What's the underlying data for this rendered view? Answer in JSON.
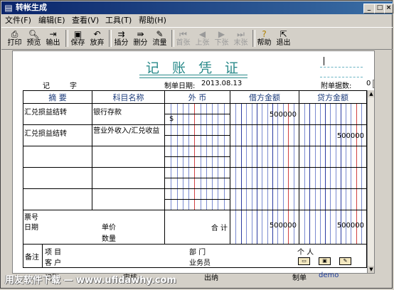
{
  "window": {
    "title": "转帐生成",
    "minimize": "_",
    "maximize": "□",
    "close": "×"
  },
  "menu": [
    "文件(F)",
    "编辑(E)",
    "查看(V)",
    "工具(T)",
    "帮助(H)"
  ],
  "toolbar": {
    "print": "打印",
    "preview": "预览",
    "export": "输出",
    "save": "保存",
    "discard": "放弃",
    "insert": "插分",
    "delete": "删分",
    "flow": "流量",
    "first": "首张",
    "prev": "上张",
    "next": "下张",
    "last": "末张",
    "help": "帮助",
    "exit": "退出"
  },
  "voucher": {
    "title": "记 账 凭 证",
    "ji": "记",
    "zi": "字",
    "date_label": "制单日期:",
    "date": "2013.08.13",
    "attach_label": "附单据数:",
    "attach_value": "0",
    "headers": {
      "summary": "摘 要",
      "subject": "科目名称",
      "foreign": "外 币",
      "debit": "借方金额",
      "credit": "贷方金额"
    },
    "rows": [
      {
        "summary": "汇兑损益结转",
        "subject": "银行存款",
        "foreign": "$",
        "debit": "500000",
        "credit": ""
      },
      {
        "summary": "汇兑损益结转",
        "subject": "营业外收入/汇兑收益",
        "foreign": "",
        "debit": "",
        "credit": "500000"
      },
      {
        "summary": "",
        "subject": "",
        "foreign": "",
        "debit": "",
        "credit": ""
      },
      {
        "summary": "",
        "subject": "",
        "foreign": "",
        "debit": "",
        "credit": ""
      },
      {
        "summary": "",
        "subject": "",
        "foreign": "",
        "debit": "",
        "credit": ""
      }
    ],
    "footer": {
      "ticket_no": "票号",
      "date": "日期",
      "unit_price": "单价",
      "quantity": "数量",
      "total": "合 计",
      "debit_total": "500000",
      "credit_total": "500000"
    },
    "notes": {
      "label": "备注",
      "project": "项 目",
      "customer": "客 户",
      "department": "部 门",
      "person": "个 人",
      "salesman": "业务员"
    }
  },
  "bottom": {
    "bookkeeper": "记账",
    "reviewer": "审核",
    "cashier": "出纳",
    "maker_label": "制单",
    "maker": "demo"
  },
  "watermark": "用友软件下载 — www.ufidawhy.com"
}
